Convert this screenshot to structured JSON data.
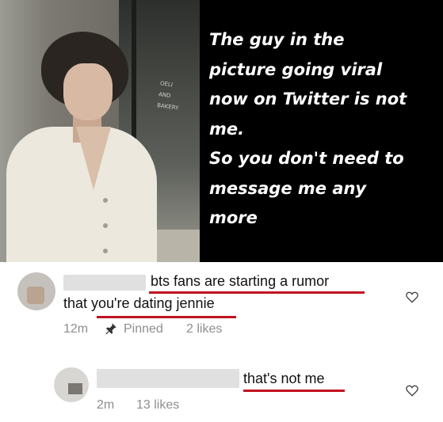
{
  "story": {
    "lines": [
      "The guy in the",
      "picture going viral",
      "now on Twitter is not",
      "me.",
      "So you don't need to",
      "message me any",
      "more"
    ]
  },
  "comments": [
    {
      "text_line1": "bts fans are starting a rumor",
      "text_line2": "that you're dating jennie",
      "time": "12m",
      "pinned_label": "Pinned",
      "likes": "2 likes"
    },
    {
      "text": "that's not me",
      "time": "2m",
      "likes": "13 likes"
    }
  ],
  "icons": {
    "like": "heart-icon",
    "pin": "pin-icon"
  },
  "colors": {
    "underline": "#c1121f",
    "meta_text": "#8e8e8e"
  }
}
